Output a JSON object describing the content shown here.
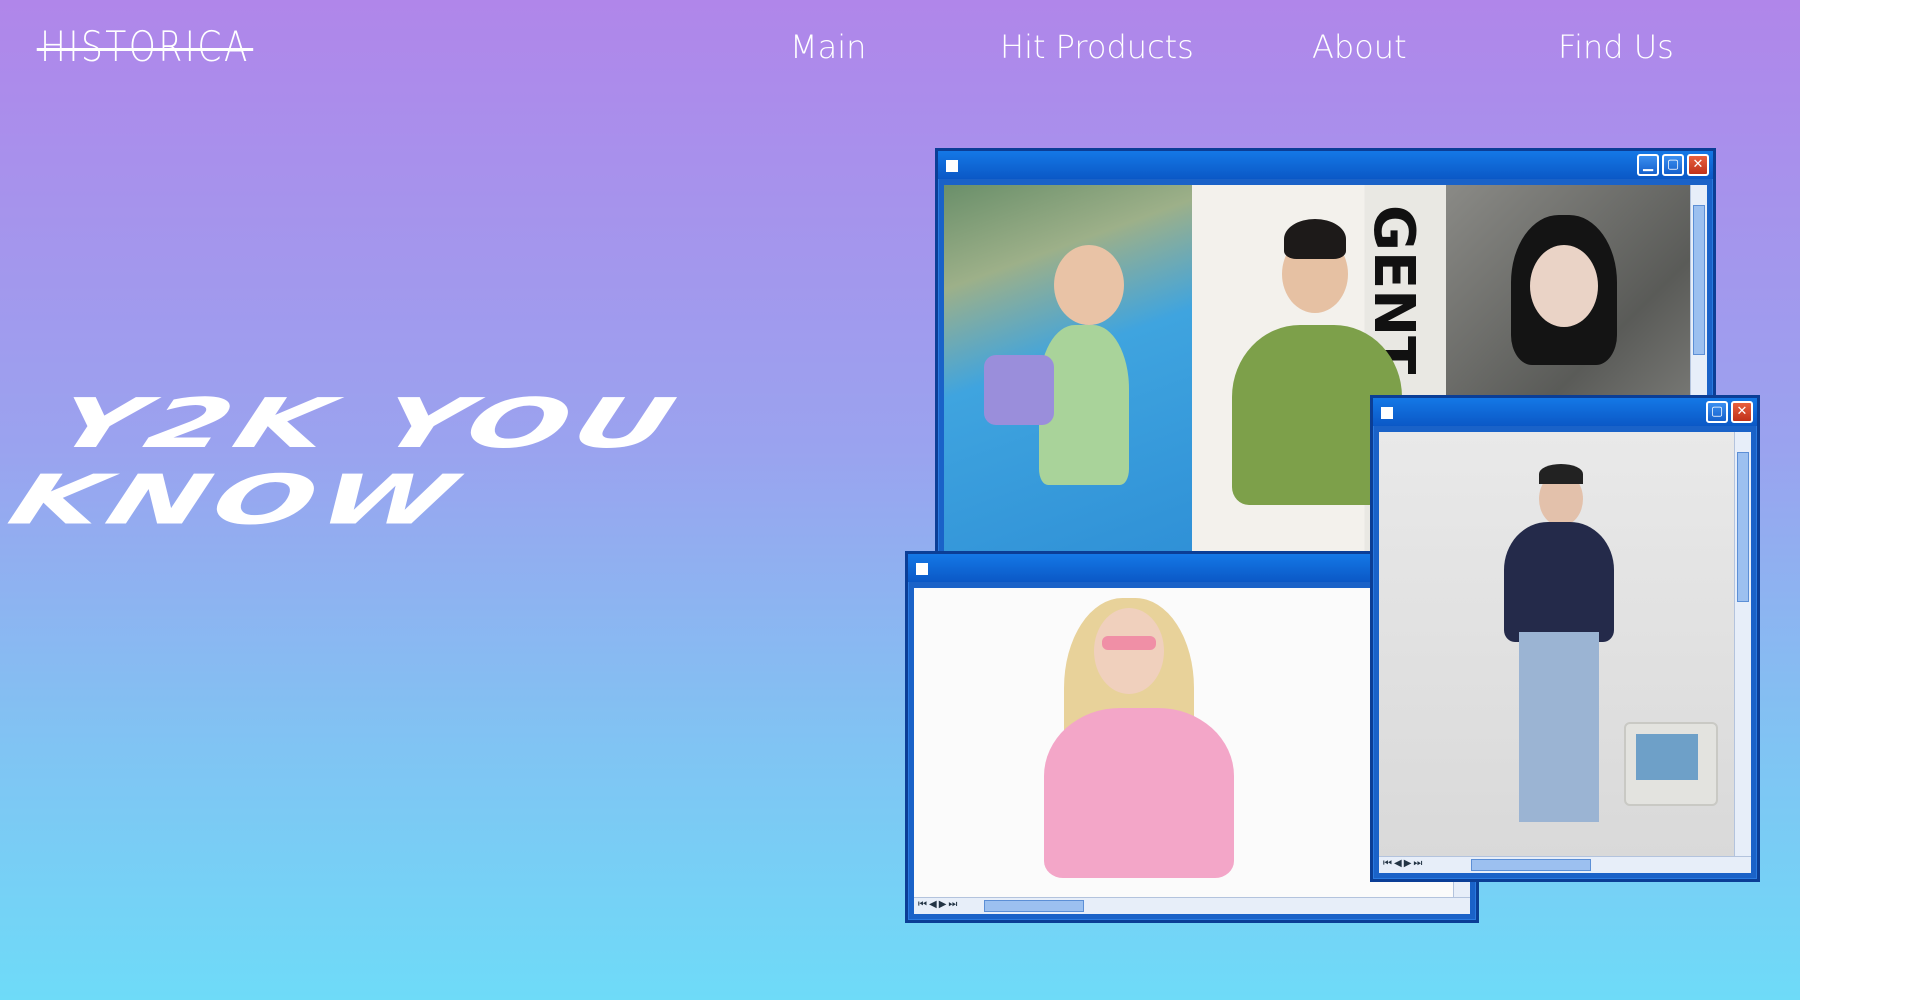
{
  "brand": {
    "logo_text": "HISTORICA"
  },
  "nav": {
    "items": [
      "Main",
      "Hit Products",
      "About",
      "Find Us"
    ]
  },
  "hero": {
    "headline_line1": "Y2K YOU",
    "headline_line2": "KNOW"
  },
  "windows": {
    "main": {
      "min": "▁",
      "max": "▢",
      "close": "✕"
    },
    "right": {
      "max": "▢",
      "close": "✕"
    },
    "controls": "⏮◀▶⏭"
  },
  "photo_text": {
    "poster_label": "GENT"
  },
  "colors": {
    "gradient_top": "#b086ea",
    "gradient_bottom": "#6edbf8",
    "window_blue": "#1a62c8"
  }
}
